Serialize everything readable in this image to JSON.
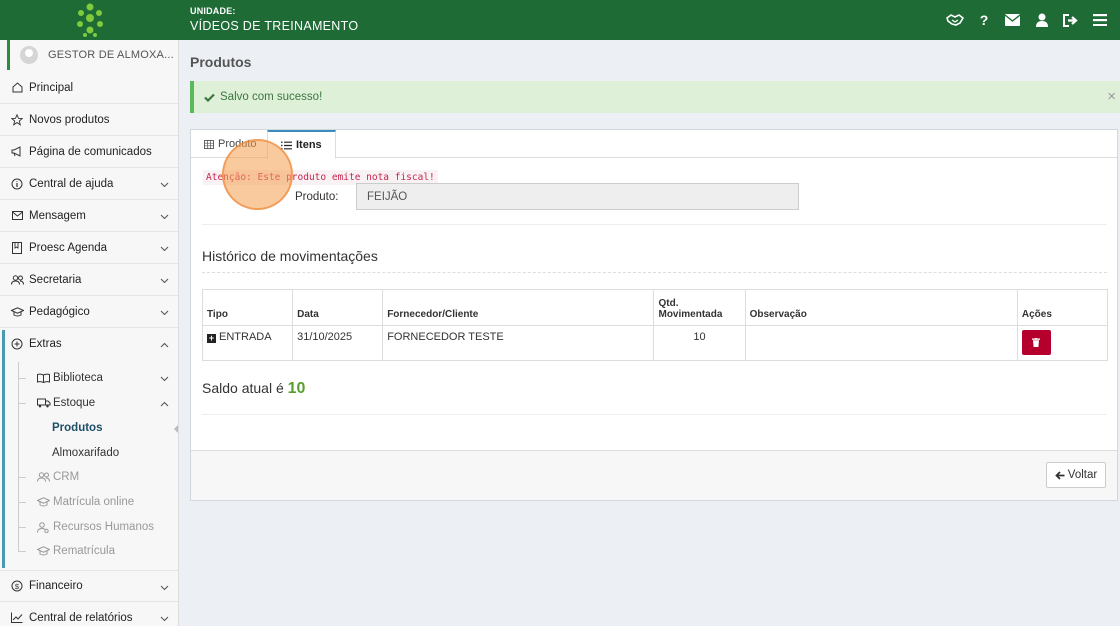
{
  "colors": {
    "header": "#1e6b36",
    "accent": "#3c8dbc",
    "success": "#5cb85c",
    "danger": "#b5002d",
    "saldo": "#5a9e2f"
  },
  "header": {
    "unit_label": "UNIDADE:",
    "unit_name": "VÍDEOS DE TREINAMENTO"
  },
  "sidebar": {
    "user_name": "GESTOR DE ALMOXA...",
    "items": [
      {
        "label": "Principal",
        "icon": "home-icon"
      },
      {
        "label": "Novos produtos",
        "icon": "star-icon"
      },
      {
        "label": "Página de comunicados",
        "icon": "megaphone-icon"
      },
      {
        "label": "Central de ajuda",
        "icon": "info-icon"
      },
      {
        "label": "Mensagem",
        "icon": "envelope-icon"
      },
      {
        "label": "Proesc Agenda",
        "icon": "agenda-icon"
      },
      {
        "label": "Secretaria",
        "icon": "users-icon"
      },
      {
        "label": "Pedagógico",
        "icon": "graduation-icon"
      },
      {
        "label": "Extras",
        "icon": "plus-circle-icon"
      },
      {
        "label": "Financeiro",
        "icon": "dollar-icon"
      },
      {
        "label": "Central de relatórios",
        "icon": "chart-icon"
      }
    ],
    "extras_sub": {
      "biblioteca": "Biblioteca",
      "estoque": "Estoque",
      "produtos": "Produtos",
      "almoxarifado": "Almoxarifado",
      "crm": "CRM",
      "matricula": "Matrícula online",
      "rh": "Recursos Humanos",
      "rematricula": "Rematrícula"
    }
  },
  "main": {
    "title": "Produtos",
    "alert": "Salvo com sucesso!",
    "alert_close": "×",
    "tabs": [
      {
        "label": "Produto"
      },
      {
        "label": "Itens"
      }
    ],
    "warning": "Atenção: Este produto emite nota fiscal!",
    "product_label": "Produto:",
    "product_value": "FEIJÃO",
    "history_title": "Histórico de movimentações",
    "table": {
      "headers": [
        "Tipo",
        "Data",
        "Fornecedor/Cliente",
        "Qtd.",
        "Movimentada",
        "Observação",
        "Ações"
      ],
      "rows": [
        {
          "tipo": "ENTRADA",
          "data": "31/10/2025",
          "fornecedor": "FORNECEDOR TESTE",
          "qtd": "10",
          "obs": ""
        }
      ]
    },
    "saldo_text": "Saldo atual é",
    "saldo_value": "10",
    "back_label": "Voltar"
  }
}
